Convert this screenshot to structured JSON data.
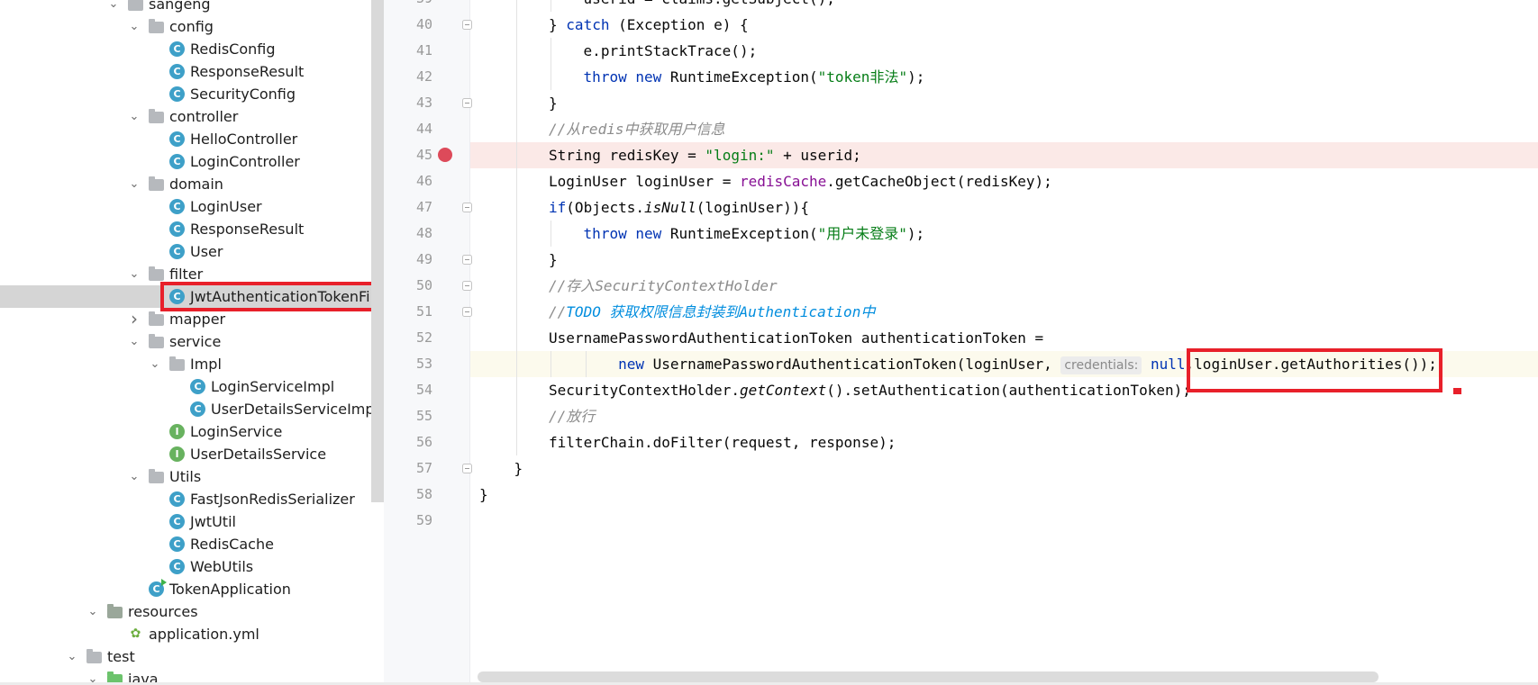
{
  "tree": {
    "items": [
      {
        "label": "sangeng",
        "type": "folder",
        "depth": 0,
        "expanded": true
      },
      {
        "label": "config",
        "type": "folder",
        "depth": 1,
        "expanded": true
      },
      {
        "label": "RedisConfig",
        "type": "class",
        "depth": 2
      },
      {
        "label": "ResponseResult",
        "type": "class",
        "depth": 2
      },
      {
        "label": "SecurityConfig",
        "type": "class",
        "depth": 2
      },
      {
        "label": "controller",
        "type": "folder",
        "depth": 1,
        "expanded": true
      },
      {
        "label": "HelloController",
        "type": "class",
        "depth": 2
      },
      {
        "label": "LoginController",
        "type": "class",
        "depth": 2
      },
      {
        "label": "domain",
        "type": "folder",
        "depth": 1,
        "expanded": true
      },
      {
        "label": "LoginUser",
        "type": "class",
        "depth": 2
      },
      {
        "label": "ResponseResult",
        "type": "class",
        "depth": 2
      },
      {
        "label": "User",
        "type": "class",
        "depth": 2
      },
      {
        "label": "filter",
        "type": "folder",
        "depth": 1,
        "expanded": true
      },
      {
        "label": "JwtAuthenticationTokenFilter",
        "type": "class",
        "depth": 2,
        "selected": true
      },
      {
        "label": "mapper",
        "type": "folder",
        "depth": 1,
        "expanded": false
      },
      {
        "label": "service",
        "type": "folder",
        "depth": 1,
        "expanded": true
      },
      {
        "label": "Impl",
        "type": "folder",
        "depth": 2,
        "expanded": true
      },
      {
        "label": "LoginServiceImpl",
        "type": "class",
        "depth": 3
      },
      {
        "label": "UserDetailsServiceImpl",
        "type": "class",
        "depth": 3
      },
      {
        "label": "LoginService",
        "type": "interface",
        "depth": 2
      },
      {
        "label": "UserDetailsService",
        "type": "interface",
        "depth": 2
      },
      {
        "label": "Utils",
        "type": "folder",
        "depth": 1,
        "expanded": true
      },
      {
        "label": "FastJsonRedisSerializer",
        "type": "class",
        "depth": 2
      },
      {
        "label": "JwtUtil",
        "type": "class",
        "depth": 2
      },
      {
        "label": "RedisCache",
        "type": "class",
        "depth": 2
      },
      {
        "label": "WebUtils",
        "type": "class",
        "depth": 2
      },
      {
        "label": "TokenApplication",
        "type": "app",
        "depth": 1
      },
      {
        "label": "resources",
        "type": "resfolder",
        "depth": -1,
        "expanded": true
      },
      {
        "label": "application.yml",
        "type": "yml",
        "depth": 0
      },
      {
        "label": "test",
        "type": "folder",
        "depth": -2,
        "expanded": true
      },
      {
        "label": "java",
        "type": "greenfolder",
        "depth": -1,
        "expanded": true
      }
    ]
  },
  "editor": {
    "first_line_number": 39,
    "breakpoint_line": 45,
    "caret_line": 53,
    "lines": [
      {
        "n": 39,
        "indent": 3,
        "tokens": [
          [
            "",
            "userid = claims.getSubject();"
          ]
        ]
      },
      {
        "n": 40,
        "indent": 2,
        "tokens": [
          [
            "",
            "} "
          ],
          [
            "kw",
            "catch"
          ],
          [
            "",
            " (Exception e) {"
          ]
        ]
      },
      {
        "n": 41,
        "indent": 3,
        "tokens": [
          [
            "",
            "e.printStackTrace();"
          ]
        ]
      },
      {
        "n": 42,
        "indent": 3,
        "tokens": [
          [
            "kw",
            "throw new"
          ],
          [
            "",
            " RuntimeException("
          ],
          [
            "str",
            "\"token非法\""
          ],
          [
            "",
            ");"
          ]
        ]
      },
      {
        "n": 43,
        "indent": 2,
        "tokens": [
          [
            "",
            "}"
          ]
        ]
      },
      {
        "n": 44,
        "indent": 2,
        "tokens": [
          [
            "cmt",
            "//从redis中获取用户信息"
          ]
        ]
      },
      {
        "n": 45,
        "indent": 2,
        "tokens": [
          [
            "",
            "String redisKey = "
          ],
          [
            "str",
            "\"login:\""
          ],
          [
            "",
            " + userid;"
          ]
        ]
      },
      {
        "n": 46,
        "indent": 2,
        "tokens": [
          [
            "",
            "LoginUser loginUser = "
          ],
          [
            "field",
            "redisCache"
          ],
          [
            "",
            ".getCacheObject(redisKey);"
          ]
        ]
      },
      {
        "n": 47,
        "indent": 2,
        "tokens": [
          [
            "kw",
            "if"
          ],
          [
            "",
            "(Objects."
          ],
          [
            "ital",
            "isNull"
          ],
          [
            "",
            "(loginUser)){"
          ]
        ]
      },
      {
        "n": 48,
        "indent": 3,
        "tokens": [
          [
            "kw",
            "throw new"
          ],
          [
            "",
            " RuntimeException("
          ],
          [
            "str",
            "\"用户未登录\""
          ],
          [
            "",
            ");"
          ]
        ]
      },
      {
        "n": 49,
        "indent": 2,
        "tokens": [
          [
            "",
            "}"
          ]
        ]
      },
      {
        "n": 50,
        "indent": 2,
        "tokens": [
          [
            "cmt",
            "//存入SecurityContextHolder"
          ]
        ]
      },
      {
        "n": 51,
        "indent": 2,
        "tokens": [
          [
            "cmt",
            "//"
          ],
          [
            "todo",
            "TODO 获取权限信息封装到Authentication中"
          ]
        ]
      },
      {
        "n": 52,
        "indent": 2,
        "tokens": [
          [
            "",
            "UsernamePasswordAuthenticationToken authenticationToken ="
          ]
        ]
      },
      {
        "n": 53,
        "indent": 4,
        "tokens": [
          [
            "kw",
            "new"
          ],
          [
            "",
            " UsernamePasswordAuthenticationToken(loginUser, "
          ],
          [
            "hint",
            "credentials:"
          ],
          [
            "",
            " "
          ],
          [
            "kw",
            "null"
          ],
          [
            "",
            ","
          ],
          [
            "",
            "loginUser.getAuthorities());"
          ]
        ]
      },
      {
        "n": 54,
        "indent": 2,
        "tokens": [
          [
            "",
            "SecurityContextHolder."
          ],
          [
            "ital",
            "getContext"
          ],
          [
            "",
            "().setAuthentication(authenticationToken);"
          ]
        ]
      },
      {
        "n": 55,
        "indent": 2,
        "tokens": [
          [
            "cmt",
            "//放行"
          ]
        ]
      },
      {
        "n": 56,
        "indent": 2,
        "tokens": [
          [
            "",
            "filterChain.doFilter(request, response);"
          ]
        ]
      },
      {
        "n": 57,
        "indent": 1,
        "tokens": [
          [
            "",
            "}"
          ]
        ]
      },
      {
        "n": 58,
        "indent": 0,
        "tokens": [
          [
            "",
            "}"
          ]
        ]
      },
      {
        "n": 59,
        "indent": 0,
        "tokens": []
      }
    ]
  },
  "annotations": {
    "highlight_color": "#e8202a",
    "tree_highlight": "JwtAuthenticationTokenFilter",
    "code_highlight": "loginUser.getAuthorities());"
  }
}
